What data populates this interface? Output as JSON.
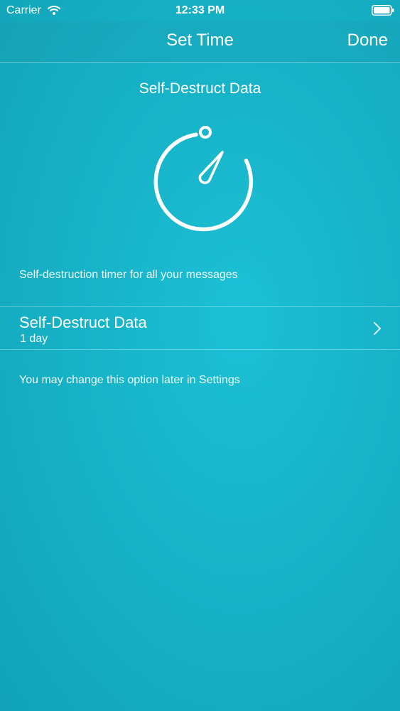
{
  "status_bar": {
    "carrier": "Carrier",
    "time": "12:33 PM",
    "wifi_icon": "wifi-icon",
    "battery_icon": "battery-icon"
  },
  "nav": {
    "title": "Set Time",
    "done_label": "Done"
  },
  "content": {
    "section_title": "Self-Destruct Data",
    "timer_icon": "stopwatch-icon",
    "caption": "Self-destruction timer for all your messages",
    "row": {
      "title": "Self-Destruct Data",
      "value": "1 day",
      "chevron_icon": "chevron-right-icon"
    },
    "note": "You may change this option later in Settings"
  },
  "colors": {
    "background": "#17b3c8",
    "foreground": "#ffffff"
  }
}
